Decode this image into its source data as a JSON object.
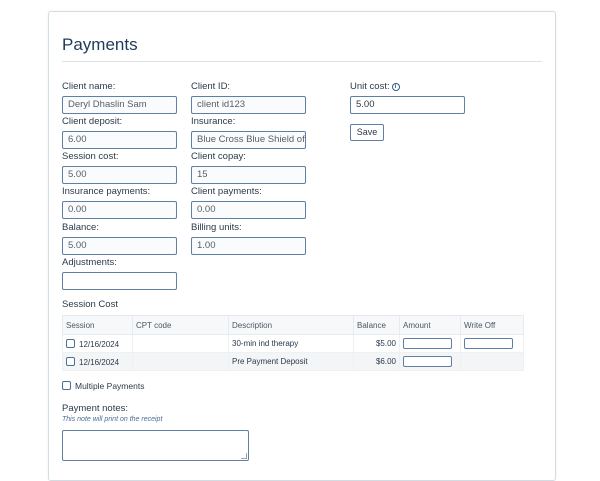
{
  "page": {
    "title": "Payments"
  },
  "fields": {
    "client_name": {
      "label": "Client name:",
      "value": "Deryl Dhaslin Sam"
    },
    "client_id": {
      "label": "Client ID:",
      "value": "client id123"
    },
    "unit_cost": {
      "label": "Unit cost:",
      "value": "5.00"
    },
    "client_deposit": {
      "label": "Client deposit:",
      "value": "6.00"
    },
    "insurance": {
      "label": "Insurance:",
      "value": "Blue Cross Blue Shield of"
    },
    "session_cost": {
      "label": "Session cost:",
      "value": "5.00"
    },
    "client_copay": {
      "label": "Client copay:",
      "value": "15"
    },
    "insurance_payments": {
      "label": "Insurance payments:",
      "value": "0.00"
    },
    "client_payments": {
      "label": "Client payments:",
      "value": "0.00"
    },
    "balance": {
      "label": "Balance:",
      "value": "5.00"
    },
    "billing_units": {
      "label": "Billing units:",
      "value": "1.00"
    },
    "adjustments": {
      "label": "Adjustments:",
      "value": ""
    }
  },
  "save_label": "Save",
  "session_cost_section": {
    "title": "Session Cost",
    "columns": [
      "Session",
      "CPT code",
      "Description",
      "Balance",
      "Amount",
      "Write Off"
    ],
    "rows": [
      {
        "session": "12/16/2024",
        "cpt": "",
        "description": "30-min ind therapy",
        "balance": "$5.00"
      },
      {
        "session": "12/16/2024",
        "cpt": "",
        "description": "Pre Payment Deposit",
        "balance": "$6.00"
      }
    ]
  },
  "multiple_payments_label": "Multiple Payments",
  "notes": {
    "label": "Payment notes:",
    "hint": "This note will print on the receipt",
    "value": ""
  },
  "colors": {
    "accent": "#5f7fa3",
    "title": "#1f3a5a"
  }
}
